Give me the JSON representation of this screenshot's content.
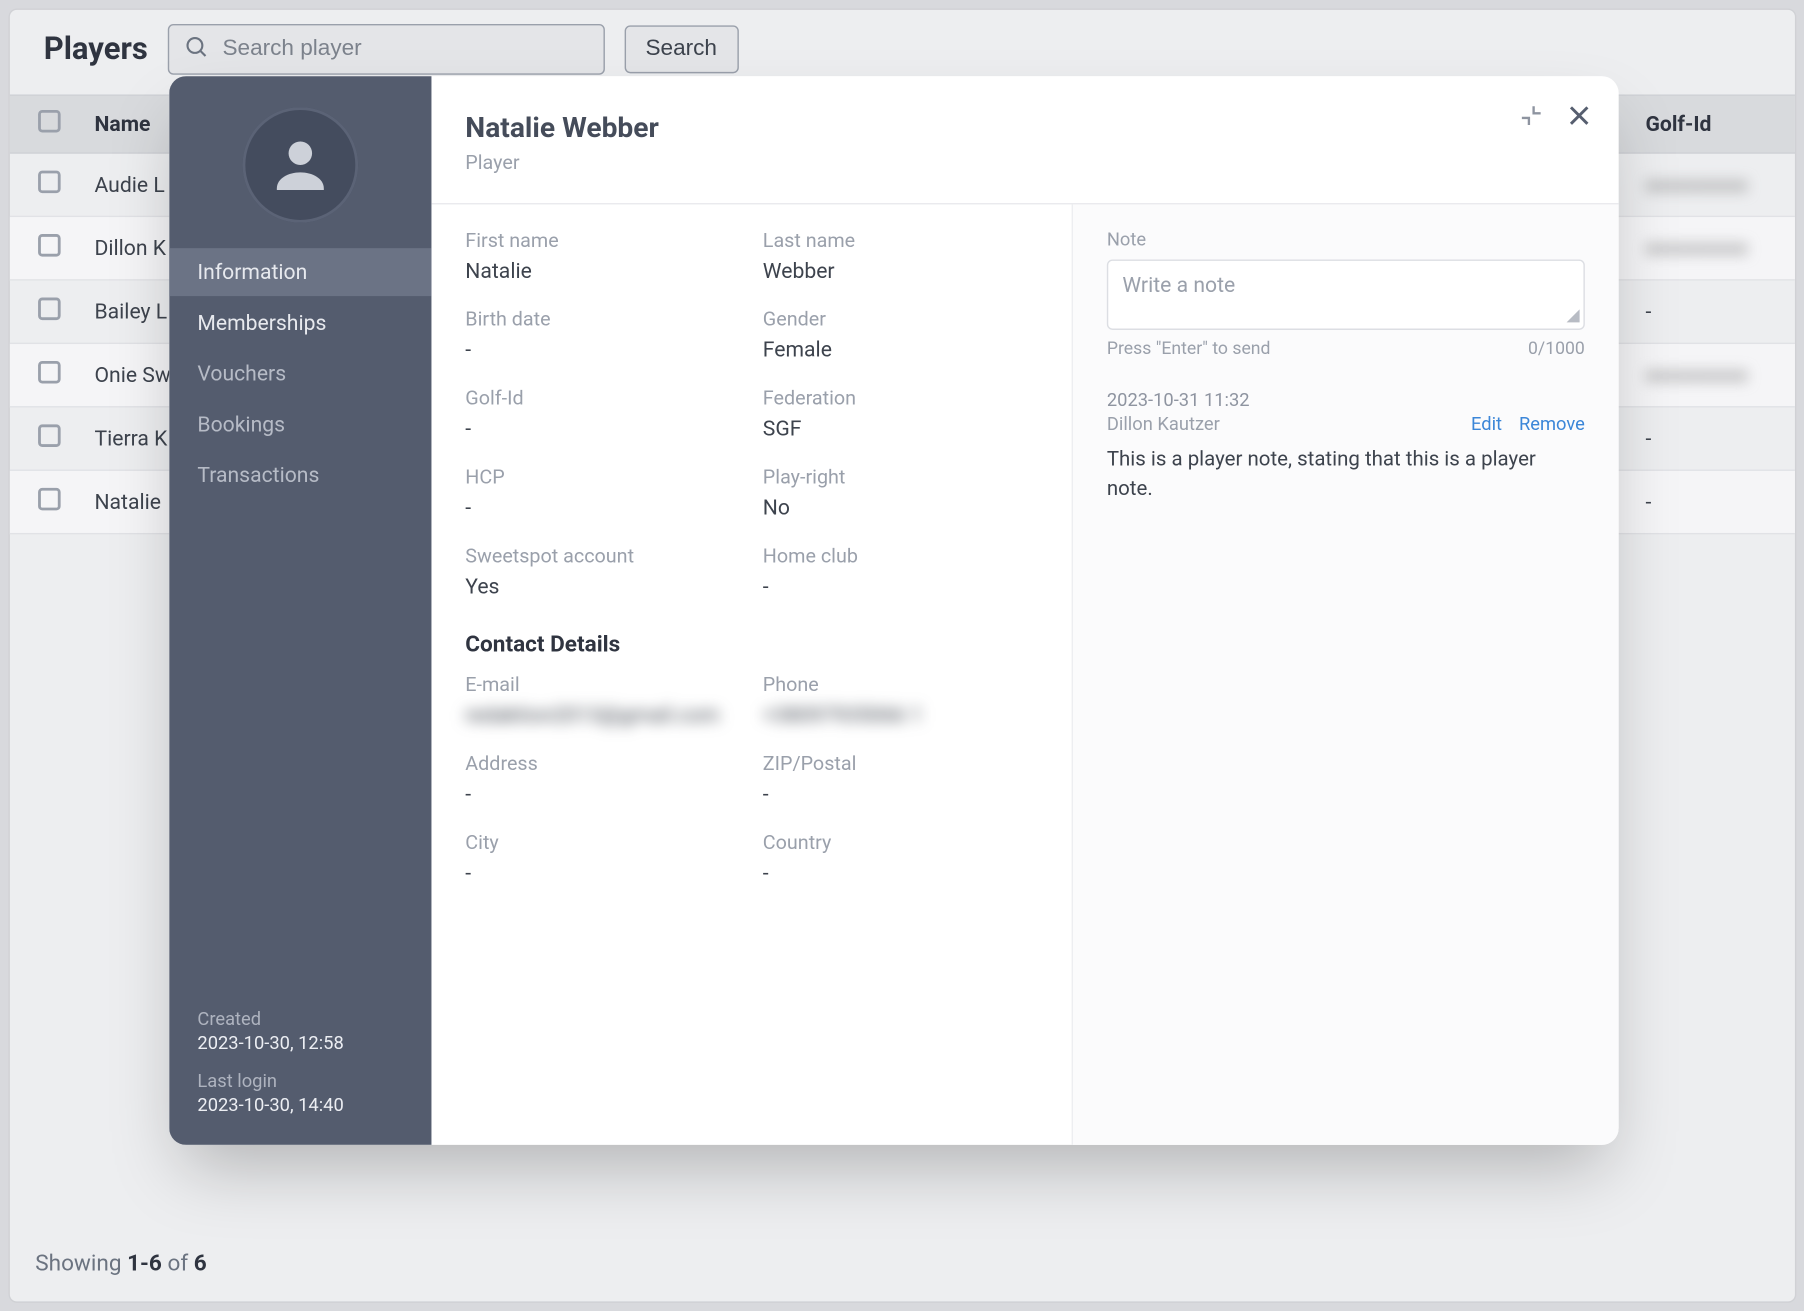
{
  "header": {
    "title": "Players",
    "search_placeholder": "Search player",
    "search_button": "Search"
  },
  "table": {
    "columns": {
      "name": "Name",
      "golf_id": "Golf-Id"
    },
    "rows": [
      {
        "name": "Audie L",
        "golf_id": "●●●●●●●●"
      },
      {
        "name": "Dillon K",
        "golf_id": "●●●●●●●●"
      },
      {
        "name": "Bailey L",
        "golf_id": "-"
      },
      {
        "name": "Onie Sw",
        "golf_id": "●●●●●●●●"
      },
      {
        "name": "Tierra K",
        "golf_id": "-"
      },
      {
        "name": "Natalie",
        "golf_id": "-"
      }
    ]
  },
  "pager": {
    "prefix": "Showing ",
    "range": "1-6",
    "of": " of ",
    "total": "6"
  },
  "modal": {
    "player_name": "Natalie Webber",
    "player_role": "Player",
    "sidebar": {
      "items": [
        {
          "key": "info",
          "label": "Information",
          "active": true
        },
        {
          "key": "memberships",
          "label": "Memberships"
        },
        {
          "key": "vouchers",
          "label": "Vouchers",
          "muted": true
        },
        {
          "key": "bookings",
          "label": "Bookings",
          "muted": true
        },
        {
          "key": "transactions",
          "label": "Transactions",
          "muted": true
        }
      ],
      "created_label": "Created",
      "created_value": "2023-10-30, 12:58",
      "last_login_label": "Last login",
      "last_login_value": "2023-10-30, 14:40"
    },
    "fields": {
      "first_name": {
        "label": "First name",
        "value": "Natalie"
      },
      "last_name": {
        "label": "Last name",
        "value": "Webber"
      },
      "birth_date": {
        "label": "Birth date",
        "value": "-"
      },
      "gender": {
        "label": "Gender",
        "value": "Female"
      },
      "golf_id": {
        "label": "Golf-Id",
        "value": "-"
      },
      "federation": {
        "label": "Federation",
        "value": "SGF"
      },
      "hcp": {
        "label": "HCP",
        "value": "-"
      },
      "play_right": {
        "label": "Play-right",
        "value": "No"
      },
      "sweetspot": {
        "label": "Sweetspot account",
        "value": "Yes"
      },
      "home_club": {
        "label": "Home club",
        "value": "-"
      }
    },
    "contact": {
      "heading": "Contact Details",
      "email": {
        "label": "E-mail",
        "value": "redaktion2013@gmail.com"
      },
      "phone": {
        "label": "Phone",
        "value": "+38097935066 1"
      },
      "address": {
        "label": "Address",
        "value": "-"
      },
      "zip": {
        "label": "ZIP/Postal",
        "value": "-"
      },
      "city": {
        "label": "City",
        "value": "-"
      },
      "country": {
        "label": "Country",
        "value": "-"
      }
    },
    "notes": {
      "label": "Note",
      "placeholder": "Write a note",
      "hint": "Press \"Enter\" to send",
      "counter": "0/1000",
      "entries": [
        {
          "timestamp": "2023-10-31 11:32",
          "author": "Dillon Kautzer",
          "edit": "Edit",
          "remove": "Remove",
          "text": "This is a player note, stating that this is a player note."
        }
      ]
    }
  }
}
